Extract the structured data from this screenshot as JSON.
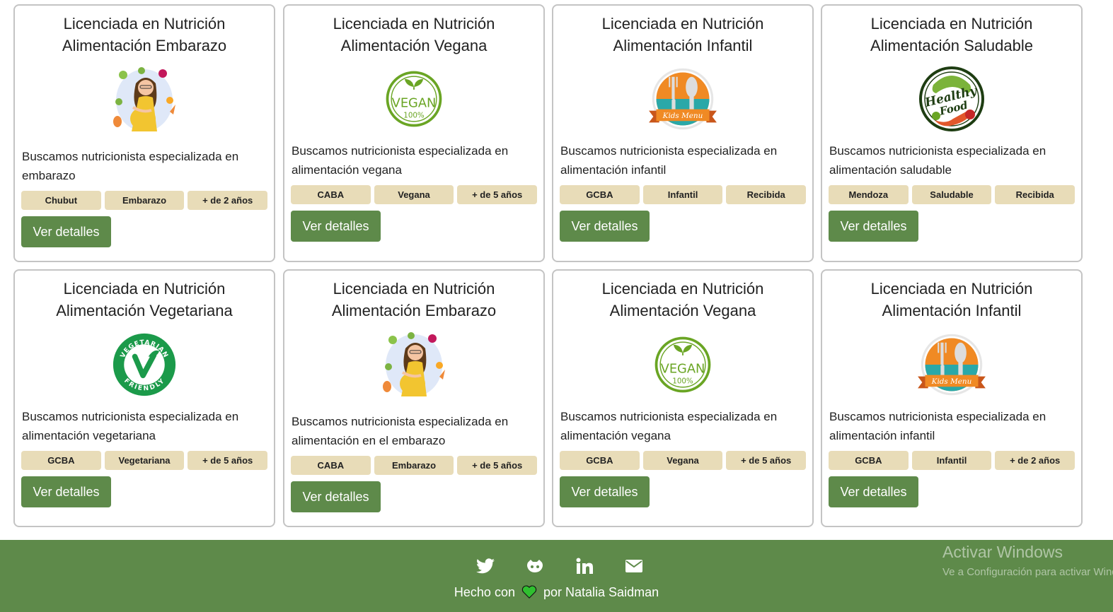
{
  "cards": [
    {
      "title_1": "Licenciada en Nutrición",
      "title_2": "Alimentación Embarazo",
      "image": "pregnant-woman-illustration",
      "description": "Buscamos nutricionista especializada en embarazo",
      "tags": [
        "Chubut",
        "Embarazo",
        "+ de 2 años"
      ],
      "button": "Ver detalles"
    },
    {
      "title_1": "Licenciada en Nutrición",
      "title_2": "Alimentación Vegana",
      "image": "vegan-100-badge",
      "description": "Buscamos nutricionista especializada en alimentación vegana",
      "tags": [
        "CABA",
        "Vegana",
        "+ de 5 años"
      ],
      "button": "Ver detalles"
    },
    {
      "title_1": "Licenciada en Nutrición",
      "title_2": "Alimentación Infantil",
      "image": "kids-menu-badge",
      "description": "Buscamos nutricionista especializada en alimentación infantil",
      "tags": [
        "GCBA",
        "Infantil",
        "Recibida"
      ],
      "button": "Ver detalles"
    },
    {
      "title_1": "Licenciada en Nutrición",
      "title_2": "Alimentación Saludable",
      "image": "healthy-food-badge",
      "description": "Buscamos nutricionista especializada en alimentación saludable",
      "tags": [
        "Mendoza",
        "Saludable",
        "Recibida"
      ],
      "button": "Ver detalles"
    },
    {
      "title_1": "Licenciada en Nutrición",
      "title_2": "Alimentación Vegetariana",
      "image": "vegetarian-friendly-badge",
      "description": "Buscamos nutricionista especializada en alimentación vegetariana",
      "tags": [
        "GCBA",
        "Vegetariana",
        "+ de 5 años"
      ],
      "button": "Ver detalles"
    },
    {
      "title_1": "Licenciada en Nutrición",
      "title_2": "Alimentación Embarazo",
      "image": "pregnant-woman-illustration",
      "description": "Buscamos nutricionista especializada en alimentación en el embarazo",
      "tags": [
        "CABA",
        "Embarazo",
        "+ de 5 años"
      ],
      "button": "Ver detalles"
    },
    {
      "title_1": "Licenciada en Nutrición",
      "title_2": "Alimentación Vegana",
      "image": "vegan-100-badge",
      "description": "Buscamos nutricionista especializada en alimentación vegana",
      "tags": [
        "GCBA",
        "Vegana",
        "+ de 5 años"
      ],
      "button": "Ver detalles"
    },
    {
      "title_1": "Licenciada en Nutrición",
      "title_2": "Alimentación Infantil",
      "image": "kids-menu-badge",
      "description": "Buscamos nutricionista especializada en alimentación infantil",
      "tags": [
        "GCBA",
        "Infantil",
        "+ de 2 años"
      ],
      "button": "Ver detalles"
    }
  ],
  "logos": {
    "vegan_word": "VEGAN",
    "vegan_percent": "100%",
    "kids_menu": "Kids Menu",
    "healthy_1": "Healthy",
    "healthy_2": "Food",
    "vegetarian_top": "VEGETARIAN",
    "vegetarian_bottom": "FRIENDLY"
  },
  "footer": {
    "social_icons": [
      "twitter-icon",
      "github-icon",
      "linkedin-icon",
      "email-icon"
    ],
    "credit_prefix": "Hecho con",
    "credit_suffix": "por Natalia Saidman"
  },
  "watermark": {
    "line_1": "Activar Windows",
    "line_2": "Ve a Configuración para activar Windows."
  },
  "colors": {
    "primary_green": "#5e8a4a",
    "tag_beige": "#e8dcb8",
    "card_border": "#c4c4c4",
    "heart_green": "#2fbf2f"
  }
}
